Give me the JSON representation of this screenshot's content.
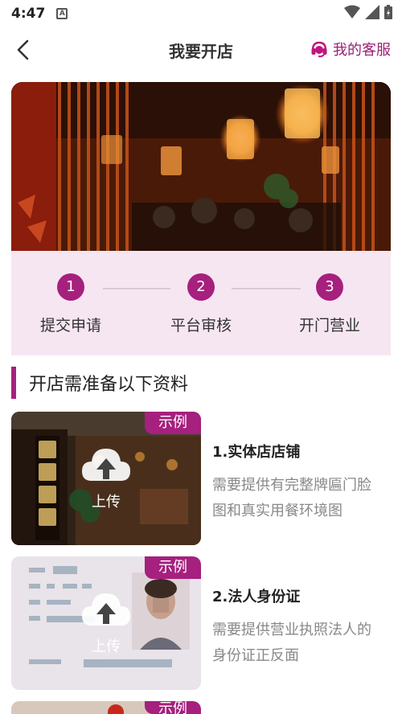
{
  "status_bar": {
    "time": "4:47",
    "notification_icon": "A"
  },
  "header": {
    "title": "我要开店",
    "service_label": "我的客服"
  },
  "steps": [
    {
      "number": "1",
      "label": "提交申请"
    },
    {
      "number": "2",
      "label": "平台审核"
    },
    {
      "number": "3",
      "label": "开门营业"
    }
  ],
  "section": {
    "title": "开店需准备以下资料"
  },
  "cards": [
    {
      "tag": "示例",
      "upload": "上传",
      "title": "1.实体店店铺",
      "desc": "需要提供有完整牌匾门脸图和真实用餐环境图"
    },
    {
      "tag": "示例",
      "upload": "上传",
      "title": "2.法人身份证",
      "desc": "需要提供营业执照法人的身份证正反面"
    },
    {
      "tag": "示例"
    }
  ],
  "colors": {
    "accent": "#a6207e",
    "step_panel_bg": "#f6e6f2"
  }
}
